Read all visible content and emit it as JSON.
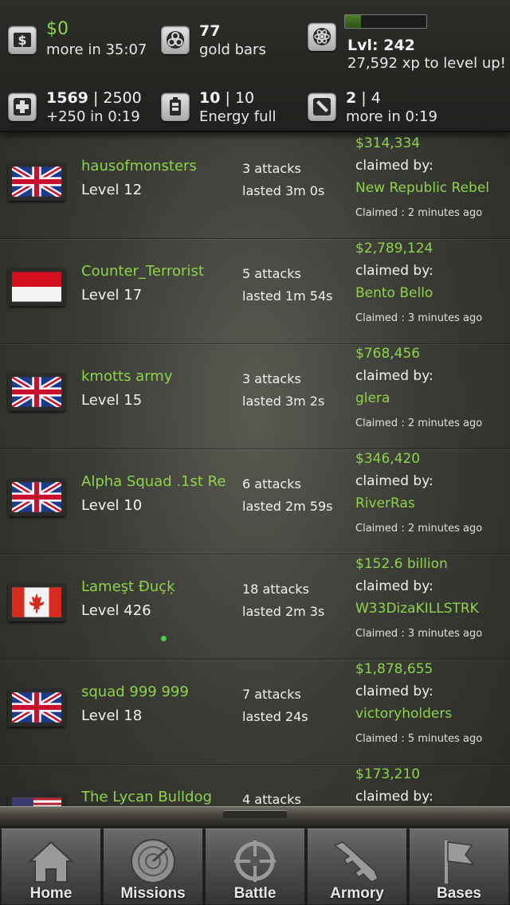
{
  "header": {
    "cash": {
      "icon": "dollar-icon",
      "value": "$0",
      "sub": "more in 35:07"
    },
    "gold": {
      "icon": "biohazard-icon",
      "value": "77",
      "sub": "gold bars"
    },
    "level": {
      "icon": "atom-icon",
      "value": "Lvl: 242",
      "sub": "27,592 xp to level up!",
      "xp_progress": 0.2
    },
    "health": {
      "icon": "medical-cross-icon",
      "value": "1569",
      "max": "| 2500",
      "sub": "+250 in 0:19"
    },
    "energy": {
      "icon": "battery-icon",
      "value": "10",
      "max": "| 10",
      "sub": "Energy full"
    },
    "stamina": {
      "icon": "bullet-icon",
      "value": "2",
      "max": "| 4",
      "sub": "more in 0:19"
    }
  },
  "bounties": [
    {
      "flag": "uk",
      "name": "hausofmonsters",
      "level": "Level 12",
      "attacks": "3 attacks",
      "lasted": "lasted 3m 0s",
      "amount": "$314,334",
      "claimed_by_label": "claimed by:",
      "claimer": "New Republic Rebel",
      "claimed_time": "Claimed : 2 minutes ago",
      "online": false
    },
    {
      "flag": "indonesia",
      "name": "Counter_Terrorist",
      "level": "Level 17",
      "attacks": "5 attacks",
      "lasted": "lasted 1m 54s",
      "amount": "$2,789,124",
      "claimed_by_label": "claimed by:",
      "claimer": "Bento Bello",
      "claimed_time": "Claimed : 3 minutes ago",
      "online": false
    },
    {
      "flag": "uk",
      "name": "kmotts army",
      "level": "Level 15",
      "attacks": "3 attacks",
      "lasted": "lasted 3m 2s",
      "amount": "$768,456",
      "claimed_by_label": "claimed by:",
      "claimer": "glera",
      "claimed_time": "Claimed : 2 minutes ago",
      "online": false
    },
    {
      "flag": "uk",
      "name": "Alpha Squad .1st Re",
      "level": "Level 10",
      "attacks": "6 attacks",
      "lasted": "lasted 2m 59s",
      "amount": "$346,420",
      "claimed_by_label": "claimed by:",
      "claimer": "RiverRas",
      "claimed_time": "Claimed : 2 minutes ago",
      "online": false
    },
    {
      "flag": "canada",
      "name": "Ŀameşt Đuçķ",
      "level": "Level 426",
      "attacks": "18 attacks",
      "lasted": "lasted 2m 3s",
      "amount": "$152.6 billion",
      "claimed_by_label": "claimed by:",
      "claimer": "W33DizaKILLSTRK",
      "claimed_time": "Claimed : 3 minutes ago",
      "online": true
    },
    {
      "flag": "uk",
      "name": "squad 999 999",
      "level": "Level 18",
      "attacks": "7 attacks",
      "lasted": "lasted 24s",
      "amount": "$1,878,655",
      "claimed_by_label": "claimed by:",
      "claimer": "victoryholders",
      "claimed_time": "Claimed : 5 minutes ago",
      "online": false
    },
    {
      "flag": "usa",
      "name": "The Lycan Bulldog",
      "level": "",
      "attacks": "4 attacks",
      "lasted": "",
      "amount": "$173,210",
      "claimed_by_label": "claimed by:",
      "claimer": "",
      "claimed_time": "",
      "online": false
    }
  ],
  "nav": [
    {
      "label": "Home",
      "icon": "house-icon"
    },
    {
      "label": "Missions",
      "icon": "radar-icon"
    },
    {
      "label": "Battle",
      "icon": "crosshair-icon"
    },
    {
      "label": "Armory",
      "icon": "rifle-icon"
    },
    {
      "label": "Bases",
      "icon": "flag-icon"
    }
  ]
}
